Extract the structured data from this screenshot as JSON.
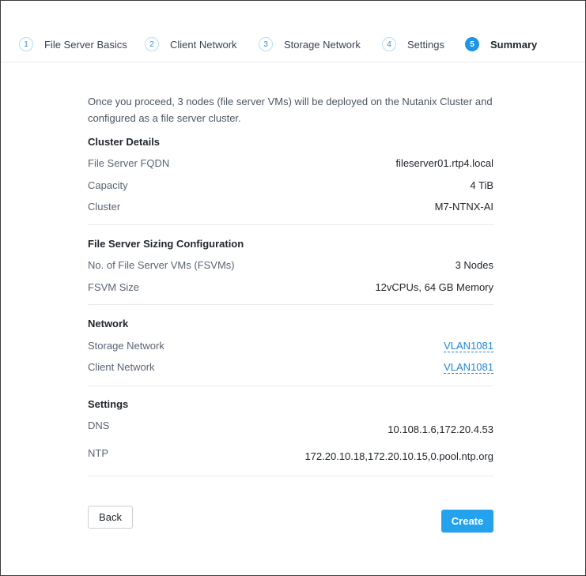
{
  "steps": [
    {
      "num": "1",
      "label": "File Server Basics"
    },
    {
      "num": "2",
      "label": "Client Network"
    },
    {
      "num": "3",
      "label": "Storage Network"
    },
    {
      "num": "4",
      "label": "Settings"
    },
    {
      "num": "5",
      "label": "Summary"
    }
  ],
  "intro": "Once you proceed, 3 nodes (file server VMs) will be deployed on the Nutanix Cluster and configured as a file server cluster.",
  "cluster_details": {
    "title": "Cluster Details",
    "fqdn_label": "File Server FQDN",
    "fqdn_value": "fileserver01.rtp4.local",
    "capacity_label": "Capacity",
    "capacity_value": "4 TiB",
    "cluster_label": "Cluster",
    "cluster_value": "M7-NTNX-AI"
  },
  "sizing": {
    "title": "File Server Sizing Configuration",
    "fsvm_count_label": "No. of File Server VMs (FSVMs)",
    "fsvm_count_value": "3 Nodes",
    "fsvm_size_label": "FSVM Size",
    "fsvm_size_value": "12vCPUs, 64 GB Memory"
  },
  "network": {
    "title": "Network",
    "storage_label": "Storage Network",
    "storage_value": "VLAN1081",
    "client_label": "Client Network",
    "client_value": "VLAN1081"
  },
  "settings": {
    "title": "Settings",
    "dns_label": "DNS",
    "dns_value": "10.108.1.6,172.20.4.53",
    "ntp_label": "NTP",
    "ntp_value": "172.20.10.18,172.20.10.15,0.pool.ntp.org"
  },
  "actions": {
    "back_label": "Back",
    "create_label": "Create"
  },
  "colors": {
    "accent": "#1f95e6",
    "link": "#1f86d8",
    "create_button": "#24a2ee"
  }
}
